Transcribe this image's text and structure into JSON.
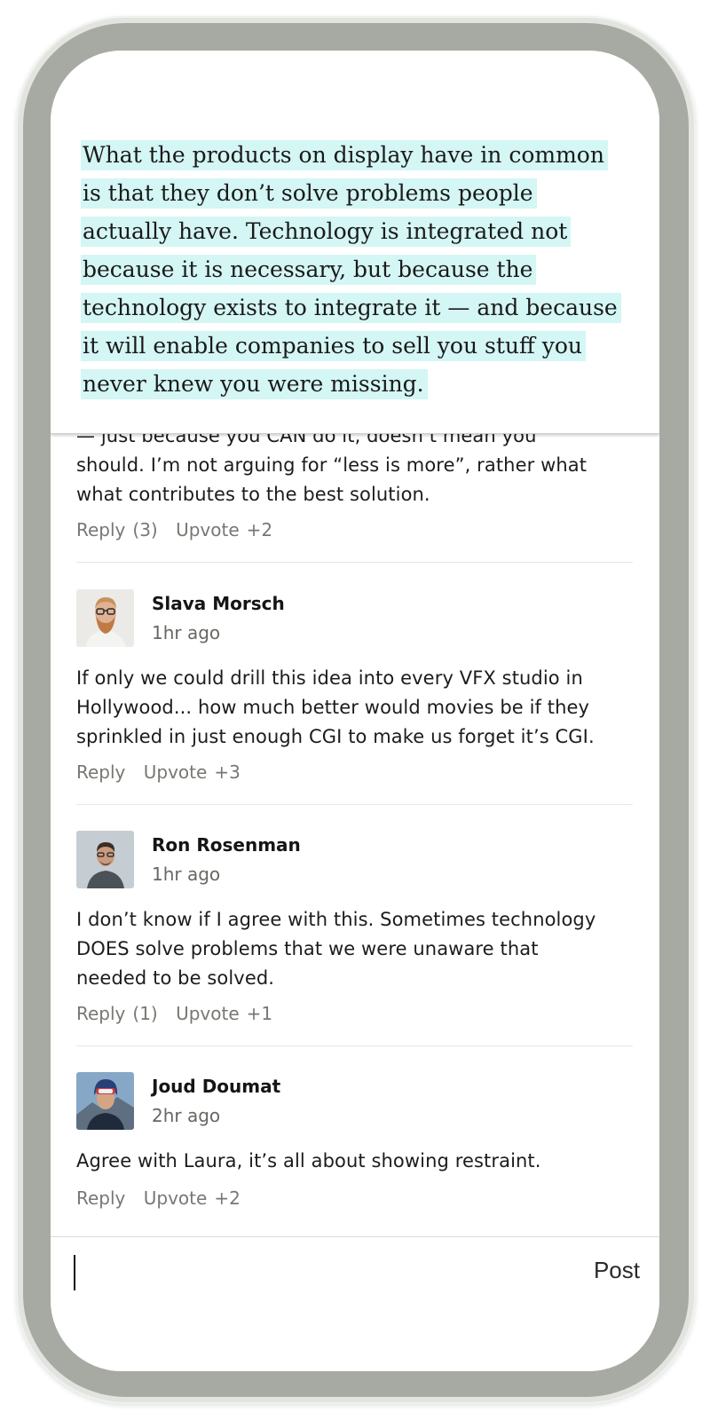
{
  "quote": {
    "text": "What the products on display have in common is that they don’t solve problems people actually have. Technology is integrated not because it is necessary, but because the technology exists to integrate it — and because it will enable companies to sell you stuff you never knew you were missing.",
    "highlight_color": "#d4f6f4"
  },
  "partial_comment": {
    "text": "— just because you CAN do it, doesn’t mean you should. I’m not arguing for “less is more”, rather what what contributes to the best solution.",
    "reply_label": "Reply",
    "reply_count": "(3)",
    "upvote_label": "Upvote",
    "upvote_count": "+2"
  },
  "comments": [
    {
      "author": "Slava Morsch",
      "time": "1hr ago",
      "text": "If only we could drill this idea into every VFX studio in Hollywood... how much better would movies be if they sprinkled in just enough CGI to make us forget it’s CGI.",
      "reply_label": "Reply",
      "reply_count": "",
      "upvote_label": "Upvote",
      "upvote_count": "+3"
    },
    {
      "author": "Ron Rosenman",
      "time": "1hr ago",
      "text": "I don’t know if I agree with this. Sometimes technology DOES solve problems that we were unaware that needed to be solved.",
      "reply_label": "Reply",
      "reply_count": "(1)",
      "upvote_label": "Upvote",
      "upvote_count": "+1"
    },
    {
      "author": "Joud Doumat",
      "time": "2hr ago",
      "text": "Agree with Laura, it’s all about showing restraint.",
      "reply_label": "Reply",
      "reply_count": "",
      "upvote_label": "Upvote",
      "upvote_count": "+2"
    }
  ],
  "composer": {
    "post_label": "Post"
  }
}
